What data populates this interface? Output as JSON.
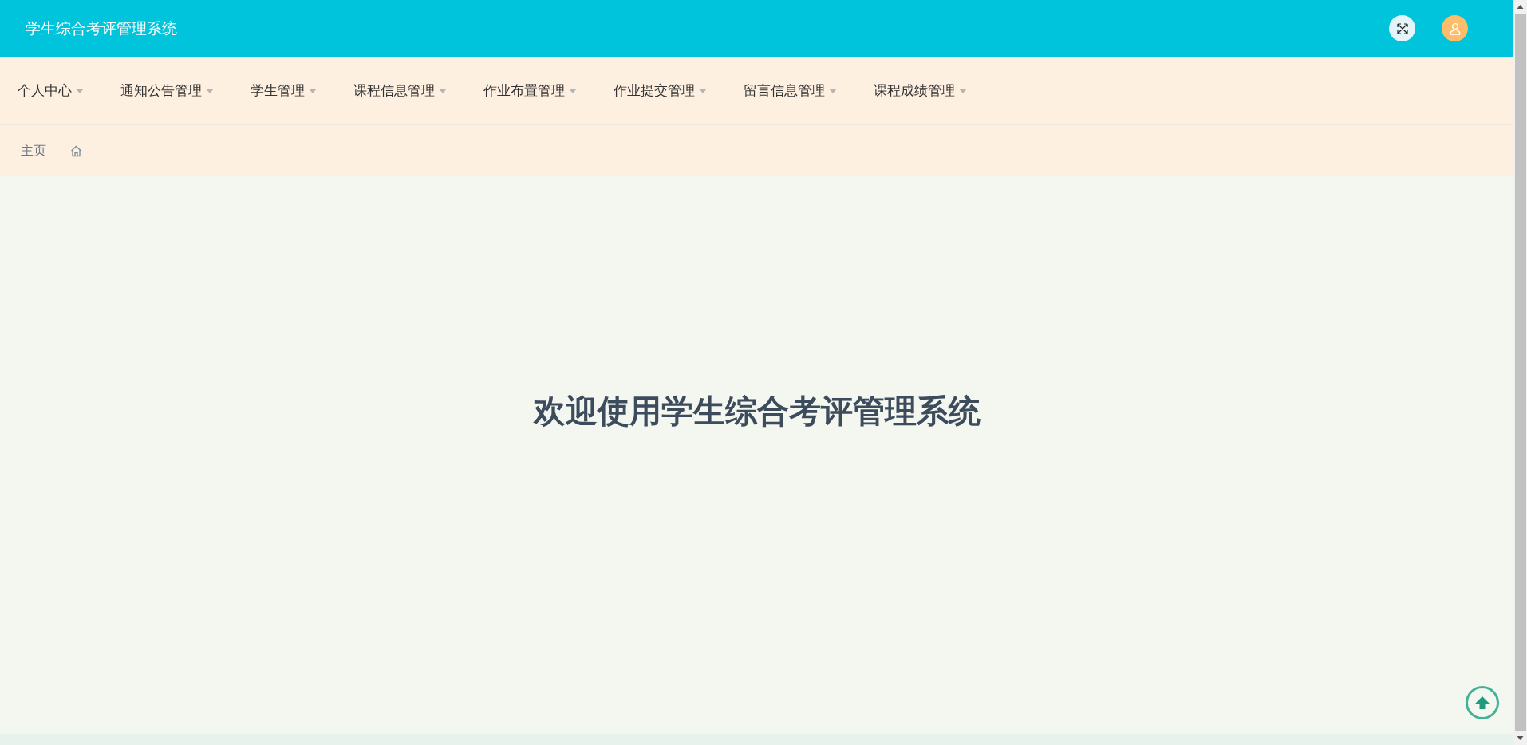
{
  "header": {
    "title": "学生综合考评管理系统"
  },
  "nav": {
    "items": [
      {
        "label": "个人中心"
      },
      {
        "label": "通知公告管理"
      },
      {
        "label": "学生管理"
      },
      {
        "label": "课程信息管理"
      },
      {
        "label": "作业布置管理"
      },
      {
        "label": "作业提交管理"
      },
      {
        "label": "留言信息管理"
      },
      {
        "label": "课程成绩管理"
      }
    ]
  },
  "breadcrumb": {
    "items": [
      {
        "label": "主页"
      }
    ]
  },
  "main": {
    "heading": "欢迎使用学生综合考评管理系统"
  }
}
